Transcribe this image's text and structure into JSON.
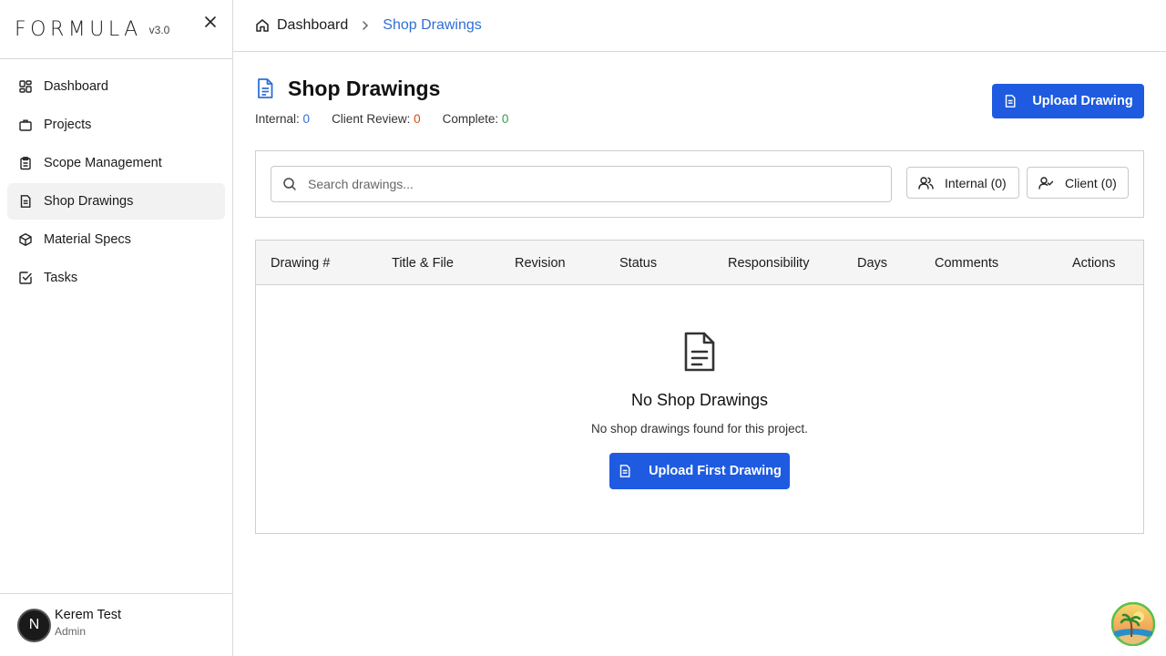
{
  "brand": {
    "name": "FORMULA",
    "version": "v3.0"
  },
  "sidebar": {
    "items": [
      {
        "label": "Dashboard",
        "icon": "grid-icon"
      },
      {
        "label": "Projects",
        "icon": "briefcase-icon"
      },
      {
        "label": "Scope Management",
        "icon": "clipboard-icon"
      },
      {
        "label": "Shop Drawings",
        "icon": "file-text-icon",
        "active": true
      },
      {
        "label": "Material Specs",
        "icon": "box-icon"
      },
      {
        "label": "Tasks",
        "icon": "check-square-icon"
      }
    ]
  },
  "user": {
    "initial": "N",
    "name": "Kerem Test",
    "role": "Admin"
  },
  "breadcrumb": {
    "home": "Dashboard",
    "current": "Shop Drawings"
  },
  "page": {
    "title": "Shop Drawings",
    "counts": [
      {
        "label": "Internal:",
        "value": "0"
      },
      {
        "label": "Client Review:",
        "value": "0"
      },
      {
        "label": "Complete:",
        "value": "0"
      }
    ],
    "upload_label": "Upload Drawing"
  },
  "filters": {
    "search_placeholder": "Search drawings...",
    "internal_label": "Internal (0)",
    "client_label": "Client (0)"
  },
  "table": {
    "columns": [
      "Drawing #",
      "Title & File",
      "Revision",
      "Status",
      "Responsibility",
      "Days",
      "Comments",
      "Actions"
    ]
  },
  "empty": {
    "title": "No Shop Drawings",
    "subtitle": "No shop drawings found for this project.",
    "button_label": "Upload First Drawing"
  },
  "colors": {
    "accent": "#1e5be0",
    "link": "#2f6fd6",
    "client_review": "#d9480f",
    "complete": "#2f9e44"
  }
}
